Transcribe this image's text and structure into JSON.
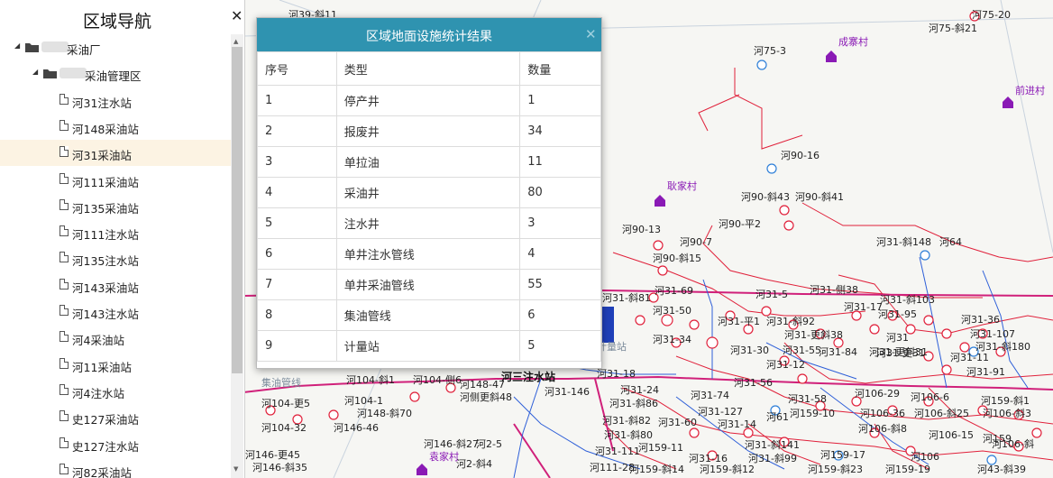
{
  "sidebar": {
    "title": "区域导航",
    "close_glyph": "✕",
    "tree": [
      {
        "label": "采油厂",
        "level": 0
      },
      {
        "label": "采油管理区",
        "level": 1
      },
      {
        "label": "河31注水站",
        "level": 2
      },
      {
        "label": "河148采油站",
        "level": 2
      },
      {
        "label": "河31采油站",
        "level": 2,
        "selected": true
      },
      {
        "label": "河111采油站",
        "level": 2
      },
      {
        "label": "河135采油站",
        "level": 2
      },
      {
        "label": "河111注水站",
        "level": 2
      },
      {
        "label": "河135注水站",
        "level": 2
      },
      {
        "label": "河143采油站",
        "level": 2
      },
      {
        "label": "河143注水站",
        "level": 2
      },
      {
        "label": "河4采油站",
        "level": 2
      },
      {
        "label": "河11采油站",
        "level": 2
      },
      {
        "label": "河4注水站",
        "level": 2
      },
      {
        "label": "史127采油站",
        "level": 2
      },
      {
        "label": "史127注水站",
        "level": 2
      },
      {
        "label": "河82采油站",
        "level": 2
      }
    ]
  },
  "dialog": {
    "title": "区域地面设施统计结果",
    "close_glyph": "✕",
    "columns": [
      "序号",
      "类型",
      "数量"
    ],
    "rows": [
      {
        "no": "1",
        "type": "停产井",
        "count": "1"
      },
      {
        "no": "2",
        "type": "报废井",
        "count": "34"
      },
      {
        "no": "3",
        "type": "单拉油",
        "count": "11"
      },
      {
        "no": "4",
        "type": "采油井",
        "count": "80"
      },
      {
        "no": "5",
        "type": "注水井",
        "count": "3"
      },
      {
        "no": "6",
        "type": "单井注水管线",
        "count": "4"
      },
      {
        "no": "7",
        "type": "单井采油管线",
        "count": "55"
      },
      {
        "no": "8",
        "type": "集油管线",
        "count": "6"
      },
      {
        "no": "9",
        "type": "计量站",
        "count": "5"
      }
    ]
  },
  "map": {
    "villages": [
      "成寨村",
      "前进村",
      "耿家村",
      "袁家村"
    ],
    "stations": [
      "河三注水站",
      "计量站",
      "集油管线"
    ],
    "well_labels": [
      "河39-斜11",
      "河75-20",
      "河75-斜21",
      "河75-3",
      "河90-16",
      "河90-斜43",
      "河90-斜41",
      "河90-平2",
      "河90-13",
      "河90-7",
      "河90-斜15",
      "河31-斜148",
      "河64",
      "河31-69",
      "河31-5",
      "河31-侧38",
      "河31-斜103",
      "河31-17",
      "河31-95",
      "河31-36",
      "河31-50",
      "河31-平1",
      "河31-斜92",
      "河31-107",
      "河31-斜180",
      "河31-34",
      "河31-更斜38",
      "河31",
      "河31-30",
      "河31-55",
      "河31-84",
      "河31-更斜31",
      "河31-11",
      "河31-12",
      "河31-91",
      "河31-56",
      "河31-18",
      "河31-24",
      "河31-146",
      "河31-74",
      "河31-58",
      "河106-29",
      "河106-6",
      "河159-斜1",
      "河148-47",
      "河侧更斜48",
      "河104-斜1",
      "河104-侧6",
      "河104-更5",
      "河104-1",
      "河148-斜70",
      "河31-斜86",
      "河31-127",
      "河159-10",
      "河106-36",
      "河106-斜25",
      "河106-斜3",
      "河104-32",
      "河146-46",
      "河31-斜82",
      "河31-60",
      "河31-14",
      "河61",
      "河106-斜8",
      "河146-斜27",
      "河2-5",
      "河31-斜80",
      "河106-15",
      "河159",
      "河106-斜",
      "河146-更45",
      "河31-111",
      "河159-11",
      "河31-斜141",
      "河146-斜35",
      "河2-斜4",
      "河31-16",
      "河31-斜99",
      "河159-17",
      "河106",
      "河111-28",
      "河159-斜14",
      "河159-斜12",
      "河159-斜23",
      "河159-19",
      "河43-斜39",
      "河31-斜81",
      "河31-更31"
    ]
  },
  "colors": {
    "dialog_header": "#2f93b0",
    "selected_row": "#fcf3e3",
    "pipeline_red": "#e0203a",
    "pipeline_magenta": "#d0207a",
    "pipeline_blue": "#2e5fd8",
    "village_purple": "#8a1ab5"
  },
  "icons": {
    "tree_expand": "triangle-down-icon",
    "folder": "folder-icon",
    "file": "file-icon",
    "close": "close-icon",
    "village": "house-icon",
    "well": "circle-icon"
  }
}
